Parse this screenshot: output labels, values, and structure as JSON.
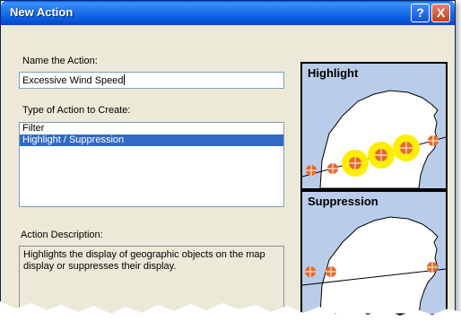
{
  "window": {
    "title": "New Action"
  },
  "title_buttons": {
    "help": "?",
    "close": "X"
  },
  "name_label": "Name  the Action:",
  "name_value": "Excessive Wind Speed",
  "type_label": "Type of Action to Create:",
  "action_types": [
    {
      "label": "Filter",
      "selected": false
    },
    {
      "label": "Highlight / Suppression",
      "selected": true
    }
  ],
  "description_label": "Action Description:",
  "description_text": "Highlights the display of geographic objects on the map display or suppresses their display.",
  "preview": {
    "highlight_title": "Highlight",
    "suppression_title": "Suppression"
  },
  "colors": {
    "title_bar": "#0a5fe0",
    "dialog_bg": "#ece9d8",
    "selection": "#316ac5",
    "map_water": "#b9cdea",
    "marker": "#e8692a",
    "highlight": "#ffee00"
  }
}
